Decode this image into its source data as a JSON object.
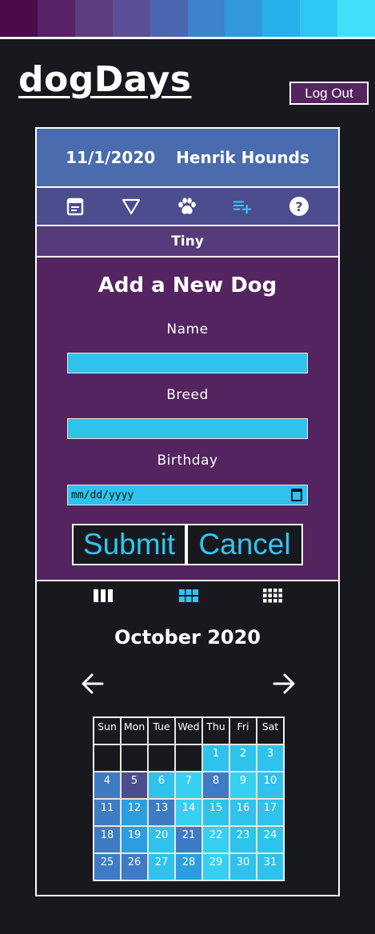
{
  "colors": {
    "stripe": [
      "#4b0b4a",
      "#582266",
      "#5d3c80",
      "#5b4e98",
      "#4c67b1",
      "#3d84cb",
      "#3298d9",
      "#27b1ea",
      "#2ec8f2",
      "#43e0fb"
    ],
    "background": "#18191e",
    "header_bar": "#4a6bad",
    "nav_bar": "#4b4d8c",
    "size_bar": "#563a79",
    "form_bg": "#53245f",
    "input_bg": "#2ec2ec",
    "accent": "#30c5f0"
  },
  "app": {
    "title": "dogDays"
  },
  "header": {
    "logout_label": "Log Out",
    "date": "11/1/2020",
    "user": "Henrik Hounds"
  },
  "nav": {
    "icons": [
      "calendar-icon",
      "filter-icon",
      "paw-icon",
      "add-list-icon",
      "help-icon"
    ],
    "active": "add-list-icon"
  },
  "size_filter": {
    "label": "Tiny"
  },
  "form": {
    "title": "Add a New Dog",
    "name_label": "Name",
    "name_value": "",
    "breed_label": "Breed",
    "breed_value": "",
    "birthday_label": "Birthday",
    "birthday_placeholder": "mm/dd/yyyy",
    "submit_label": "Submit",
    "cancel_label": "Cancel"
  },
  "calendar": {
    "views": [
      "week-view-icon",
      "month-view-icon",
      "year-view-icon"
    ],
    "active_view": "month-view-icon",
    "month_label": "October 2020",
    "weekdays": [
      "Sun",
      "Mon",
      "Tue",
      "Wed",
      "Thu",
      "Fri",
      "Sat"
    ],
    "leading_blanks": 4,
    "days": [
      {
        "d": "1",
        "c": "#2ec2ec"
      },
      {
        "d": "2",
        "c": "#2ec2ec"
      },
      {
        "d": "3",
        "c": "#2ec2ec"
      },
      {
        "d": "4",
        "c": "#3e7bc5"
      },
      {
        "d": "5",
        "c": "#4b4d8c"
      },
      {
        "d": "6",
        "c": "#2ec2ec"
      },
      {
        "d": "7",
        "c": "#36d0f2"
      },
      {
        "d": "8",
        "c": "#3e7bc5"
      },
      {
        "d": "9",
        "c": "#36d0f2"
      },
      {
        "d": "10",
        "c": "#2ec2ec"
      },
      {
        "d": "11",
        "c": "#3e7bc5"
      },
      {
        "d": "12",
        "c": "#2a9ee0"
      },
      {
        "d": "13",
        "c": "#3e7bc5"
      },
      {
        "d": "14",
        "c": "#36d0f2"
      },
      {
        "d": "15",
        "c": "#2ec2ec"
      },
      {
        "d": "16",
        "c": "#2ec2ec"
      },
      {
        "d": "17",
        "c": "#2ec2ec"
      },
      {
        "d": "18",
        "c": "#3e7bc5"
      },
      {
        "d": "19",
        "c": "#2a9ee0"
      },
      {
        "d": "20",
        "c": "#2ec2ec"
      },
      {
        "d": "21",
        "c": "#3e7bc5"
      },
      {
        "d": "22",
        "c": "#36d0f2"
      },
      {
        "d": "23",
        "c": "#2ec2ec"
      },
      {
        "d": "24",
        "c": "#2ec2ec"
      },
      {
        "d": "25",
        "c": "#3e7bc5"
      },
      {
        "d": "26",
        "c": "#3e7bc5"
      },
      {
        "d": "27",
        "c": "#2ec2ec"
      },
      {
        "d": "28",
        "c": "#2a9ee0"
      },
      {
        "d": "29",
        "c": "#36d0f2"
      },
      {
        "d": "30",
        "c": "#2ec2ec"
      },
      {
        "d": "31",
        "c": "#2ec2ec"
      }
    ]
  }
}
